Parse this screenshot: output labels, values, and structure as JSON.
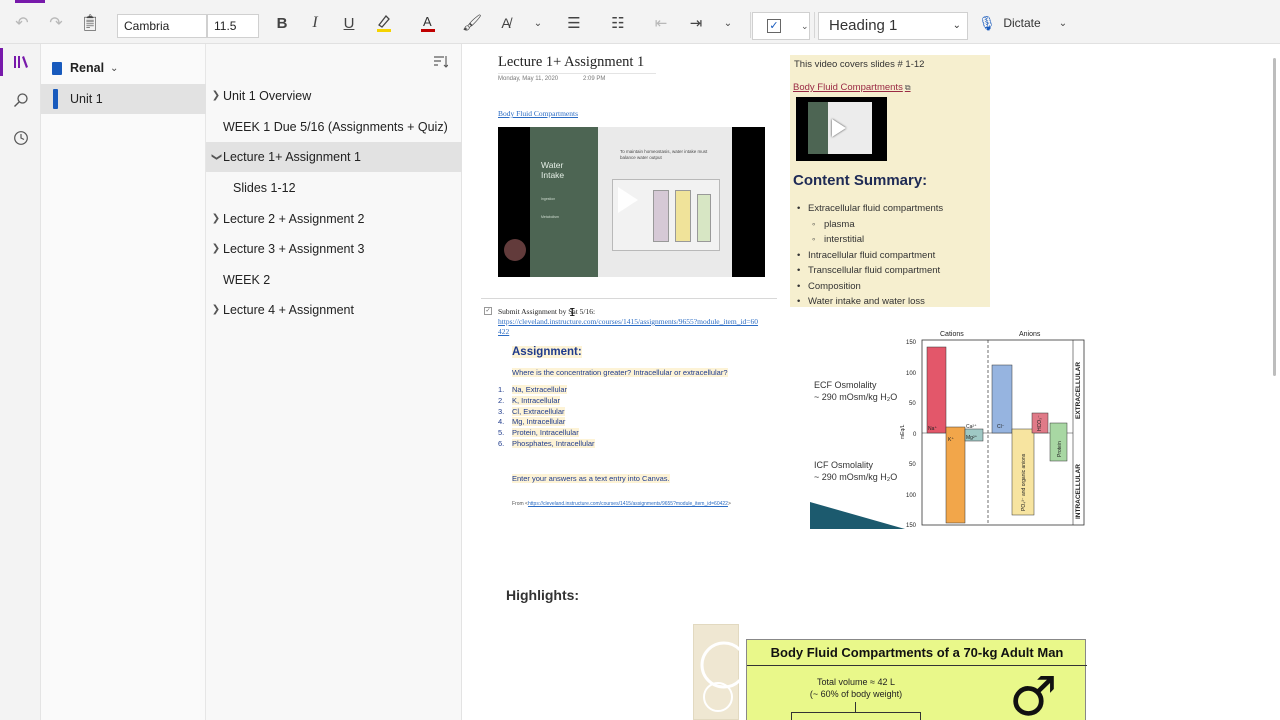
{
  "ribbon": {
    "font_name": "Cambria",
    "font_size": "11.5",
    "bold": "B",
    "italic": "I",
    "underline": "U",
    "font_color_glyph": "A",
    "style": "Heading 1",
    "dictate": "Dictate",
    "highlight_color": "#f5d300",
    "font_color": "#c00000"
  },
  "notebook": {
    "name": "Renal"
  },
  "sections": [
    {
      "label": "Unit 1",
      "color": "#185abd"
    }
  ],
  "pages": [
    {
      "label": "Unit 1 Overview",
      "expandable": true,
      "expanded": false,
      "indent": 0
    },
    {
      "label": "WEEK 1 Due 5/16 (Assignments + Quiz)",
      "expandable": false,
      "indent": 0
    },
    {
      "label": "Lecture 1+ Assignment 1",
      "expandable": true,
      "expanded": true,
      "indent": 0,
      "selected": true
    },
    {
      "label": "Slides 1-12",
      "expandable": false,
      "indent": 1
    },
    {
      "label": "Lecture 2 + Assignment 2",
      "expandable": true,
      "expanded": false,
      "indent": 0
    },
    {
      "label": "Lecture 3 + Assignment 3",
      "expandable": true,
      "expanded": false,
      "indent": 0
    },
    {
      "label": "WEEK 2",
      "expandable": false,
      "indent": 0
    },
    {
      "label": "Lecture 4 + Assignment",
      "expandable": true,
      "expanded": false,
      "indent": 0
    }
  ],
  "page": {
    "title": "Lecture 1+ Assignment 1",
    "date": "Monday, May 11, 2020",
    "time": "2:09 PM",
    "bfc_link": "Body Fluid Compartments",
    "video": {
      "slide_title_line1": "Water",
      "slide_title_line2": "Intake",
      "slide_heading": "To maintain homeostasis, water intake must balance water output",
      "mini_1": "Ingestion",
      "mini_2": "Metabolism"
    },
    "submit_text": "Submit Assignment by Sat 5/16:",
    "submit_link": "https://cleveland.instructure.com/courses/1415/assignments/9655?module_item_id=60422",
    "assignment_heading": "Assignment:",
    "question": "Where is the concentration greater? Intracellular or extracellular?",
    "answers": [
      "Na, Extracellular",
      "K, Intracellular",
      "Cl, Extracellular",
      "Mg, Intracellular",
      "Protein, Intracellular",
      "Phosphates, Intracellular"
    ],
    "enter_text": "Enter your answers as a text entry into Canvas.",
    "from_prefix": "From <",
    "from_link": "https://cleveland.instructure.com/courses/1415/assignments/9655?module_item_id=60422",
    "from_suffix": ">",
    "highlights": "Highlights:"
  },
  "info_box": {
    "covers": "This video covers slides # 1-12",
    "link": "Body Fluid Compartments",
    "summary_heading": "Content Summary:",
    "bullets": [
      {
        "text": "Extracellular fluid compartments",
        "level": 0
      },
      {
        "text": "plasma",
        "level": 1
      },
      {
        "text": "interstitial",
        "level": 1
      },
      {
        "text": "Intracellular fluid compartment",
        "level": 0
      },
      {
        "text": "Transcellular fluid compartment",
        "level": 0
      },
      {
        "text": "Composition",
        "level": 0
      },
      {
        "text": "Water intake and water loss",
        "level": 0
      }
    ],
    "bg_color": "#f6efcf"
  },
  "osmolality_figure": {
    "header_cations": "Cations",
    "header_anions": "Anions",
    "ecf_line1": "ECF Osmolality",
    "ecf_line2": "~ 290 mOsm/kg H₂O",
    "icf_line1": "ICF Osmolality",
    "icf_line2": "~ 290 mOsm/kg H₂O",
    "y_label": "mEq/L",
    "right_top": "EXTRACELLULAR",
    "right_bottom": "INTRACELLULAR",
    "ticks": [
      "150",
      "100",
      "50",
      "0",
      "50",
      "100",
      "150"
    ],
    "bar_labels": {
      "na": "Na⁺",
      "k": "K⁺",
      "ca": "Ca²⁺",
      "mg": "Mg²⁺",
      "cl": "Cl⁻",
      "hco3": "HCO₃⁻",
      "protein": "Protein",
      "po4": "PO₄³⁻ and organic anions"
    }
  },
  "highlight_card": {
    "title": "Body Fluid Compartments of a 70-kg Adult Man",
    "total_line1": "Total volume ≈ 42 L",
    "total_line2": "(~ 60% of body weight)",
    "male_symbol": "♂"
  }
}
